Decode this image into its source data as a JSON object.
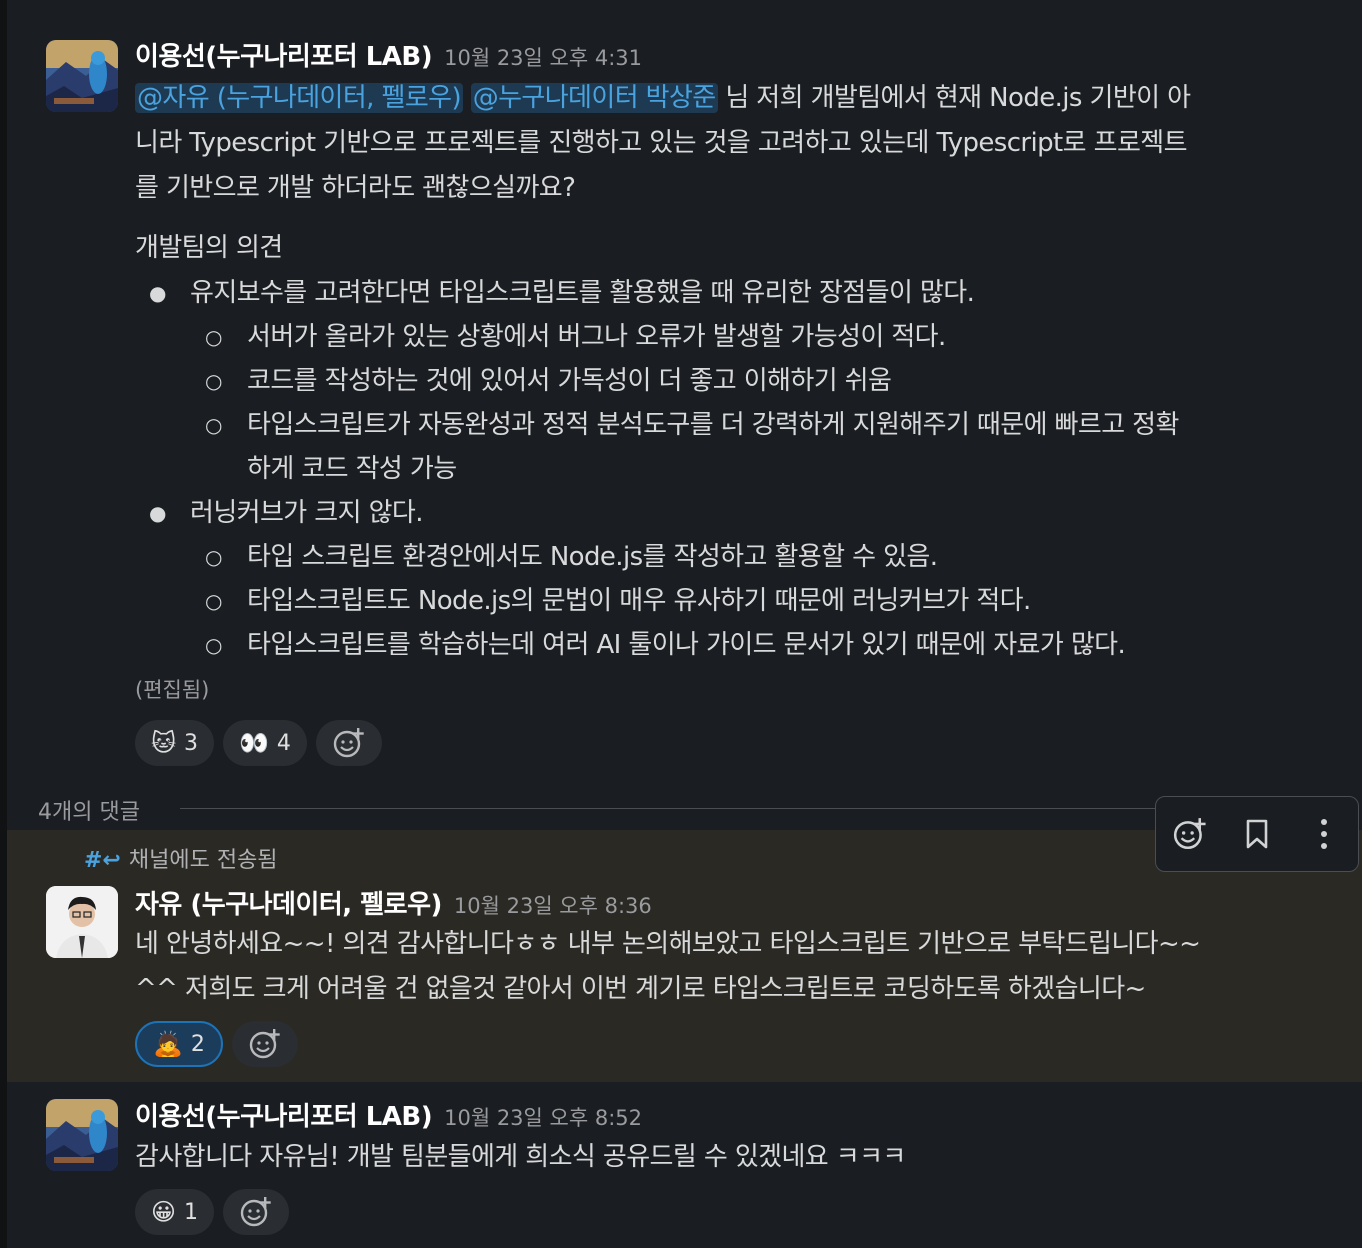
{
  "msg1": {
    "author": "이용선(누구나리포터 LAB)",
    "timestamp": "10월 23일 오후 4:31",
    "mention1": "@자유 (누구나데이터, 펠로우)",
    "mention2": "@누구나데이터 박상준",
    "text1_tail": "님 저희 개발팀에서 현재 Node.js 기반이 아",
    "text_line2": "니라 Typescript 기반으로 프로젝트를 진행하고 있는 것을 고려하고 있는데 Typescript로 프로젝트",
    "text_line3": "를 기반으로 개발 하더라도 괜찮으실까요?",
    "opinion_title": "개발팀의 의견",
    "bullets": [
      "유지보수를 고려한다면 타입스크립트를 활용했을 때 유리한 장점들이 많다.",
      "러닝커브가 크지 않다."
    ],
    "sub1": [
      "서버가 올라가 있는 상황에서 버그나 오류가 발생할 가능성이 적다.",
      "코드를 작성하는 것에 있어서 가독성이 더 좋고 이해하기 쉬움",
      "타입스크립트가 자동완성과 정적 분석도구를 더 강력하게 지원해주기 때문에 빠르고 정확",
      "하게 코드 작성 가능"
    ],
    "sub2": [
      "타입 스크립트 환경안에서도 Node.js를 작성하고 활용할 수 있음.",
      "타입스크립트도 Node.js의 문법이 매우 유사하기 때문에 러닝커브가 적다.",
      "타입스크립트를 학습하는데 여러 AI 툴이나 가이드 문서가 있기 때문에 자료가 많다."
    ],
    "edited": "(편집됨)",
    "reactions": [
      {
        "emoji": "🐱",
        "count": "3"
      },
      {
        "emoji": "👀",
        "count": "4"
      }
    ]
  },
  "thread": {
    "replies_label": "4개의 댓글",
    "forwarded": "채널에도 전송됨",
    "forward_icon": "#↩"
  },
  "msg2": {
    "author": "자유 (누구나데이터, 펠로우)",
    "timestamp": "10월 23일 오후 8:36",
    "line1": "네 안녕하세요~~! 의견 감사합니다ㅎㅎ 내부 논의해보았고 타입스크립트 기반으로 부탁드립니다~~",
    "line2": "^^ 저희도 크게 어려울 건 없을것 같아서 이번 계기로 타입스크립트로 코딩하도록 하겠습니다~",
    "reactions": [
      {
        "emoji": "🙇",
        "count": "2"
      }
    ]
  },
  "msg3": {
    "author": "이용선(누구나리포터 LAB)",
    "timestamp": "10월 23일 오후 8:52",
    "line1": "감사합니다 자유님! 개발 팀분들에게 희소식 공유드릴 수 있겠네요 ㅋㅋㅋ",
    "reactions": [
      {
        "emoji": "😀",
        "count": "1"
      }
    ]
  },
  "icons": {
    "add_reaction": "add-reaction-icon",
    "bookmark": "bookmark-icon",
    "more": "more-vertical-icon"
  }
}
